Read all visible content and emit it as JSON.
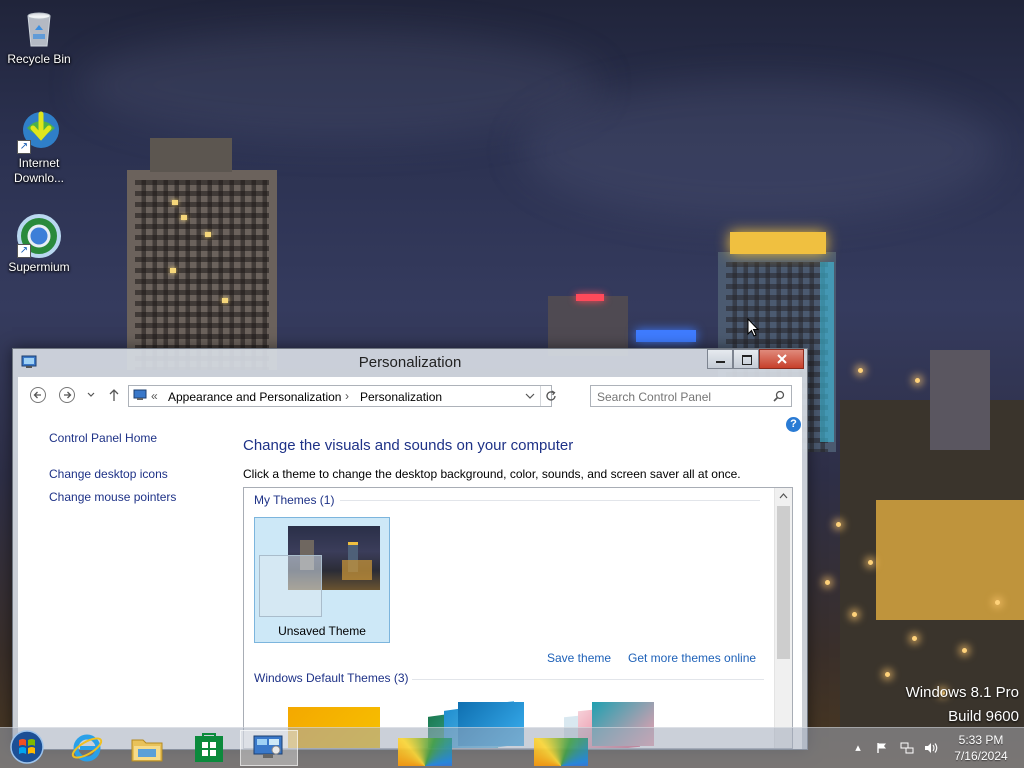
{
  "desktop": {
    "icons": [
      {
        "label": "Recycle Bin"
      },
      {
        "label": "Internet Downlo..."
      },
      {
        "label": "Supermium"
      }
    ],
    "watermark": {
      "line1": "Windows 8.1 Pro",
      "line2": "Build 9600"
    }
  },
  "window": {
    "title": "Personalization",
    "breadcrumb": {
      "overflow": "«",
      "items": [
        "Appearance and Personalization",
        "Personalization"
      ],
      "separator": "›"
    },
    "search_placeholder": "Search Control Panel",
    "sidebar": {
      "home": "Control Panel Home",
      "links": [
        "Change desktop icons",
        "Change mouse pointers"
      ]
    },
    "heading": "Change the visuals and sounds on your computer",
    "instructions": "Click a theme to change the desktop background, color, sounds, and screen saver all at once.",
    "my_themes": {
      "header": "My Themes (1)",
      "theme_name": "Unsaved Theme",
      "save_link": "Save theme",
      "online_link": "Get more themes online"
    },
    "default_themes": {
      "header": "Windows Default Themes (3)"
    }
  },
  "taskbar": {
    "clock": {
      "time": "5:33 PM",
      "date": "7/16/2024"
    }
  },
  "colors": {
    "accent_link": "#1e61b8",
    "heading_blue": "#1e3287",
    "close_red": "#c7402b",
    "selection_blue": "#cde8f7"
  }
}
